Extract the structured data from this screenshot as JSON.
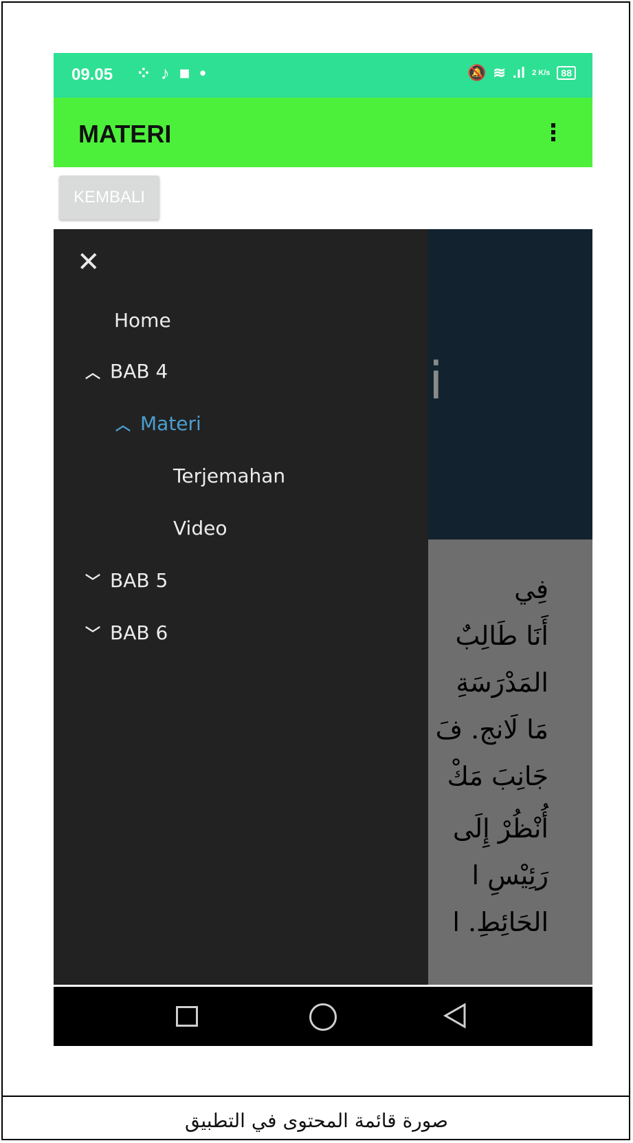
{
  "status_bar": {
    "time": "09.05",
    "left_icons": [
      "grid-icon",
      "tiktok-icon",
      "square-icon",
      "dot-icon"
    ],
    "right_icons": [
      "mute-icon",
      "wifi-icon",
      "signal-icon",
      "speed-icon"
    ],
    "speed_text": "2 K/s",
    "battery": "88"
  },
  "app_bar": {
    "title": "MATERI",
    "overflow": "⋮"
  },
  "back_button": "KEMBALI",
  "drawer": {
    "close": "✕",
    "items": [
      {
        "label": "Home",
        "chevron": ""
      },
      {
        "label": "BAB 4",
        "chevron": "︿"
      },
      {
        "label": "Materi",
        "chevron": "︿"
      },
      {
        "label": "Terjemahan",
        "chevron": ""
      },
      {
        "label": "Video",
        "chevron": ""
      },
      {
        "label": "BAB 5",
        "chevron": "﹀"
      },
      {
        "label": "BAB 6",
        "chevron": "﹀"
      }
    ]
  },
  "background_content": {
    "banner_glyph": "i",
    "arabic_lines": [
      "فِي",
      "أَنَا طَالِبٌ",
      "المَدْرَسَةِ",
      "مَا لَانج. فَ",
      "جَانِبَ مَكْ",
      "أُنْظُرْ إِلَى",
      "رَئِيْسِ ا",
      "الحَائِطِ. ا"
    ]
  },
  "caption": "صورة قائمة المحتوى في التطبيق"
}
